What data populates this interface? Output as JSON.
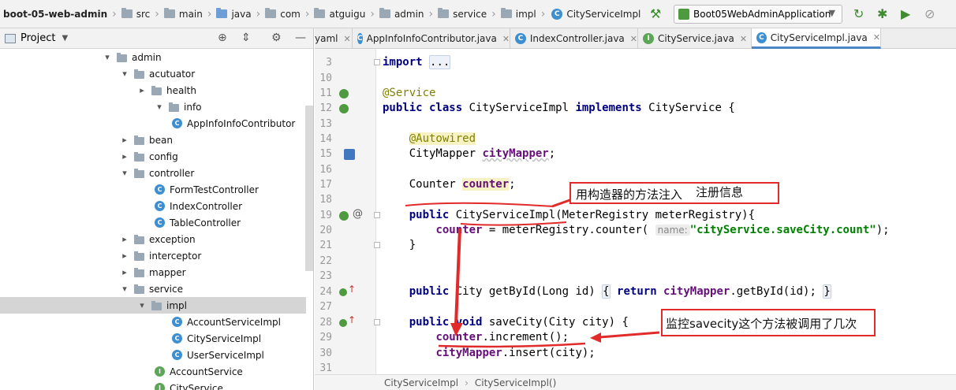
{
  "breadcrumbs": [
    "boot-05-web-admin",
    "src",
    "main",
    "java",
    "com",
    "atguigu",
    "admin",
    "service",
    "impl",
    "CityServiceImpl"
  ],
  "run_config": "Boot05WebAdminApplication",
  "project_panel": {
    "title": "Project"
  },
  "tree": [
    {
      "label": "admin",
      "kind": "folder",
      "toggle": "▾"
    },
    {
      "label": "acutuator",
      "kind": "folder",
      "toggle": "▾"
    },
    {
      "label": "health",
      "kind": "folder",
      "toggle": "▸"
    },
    {
      "label": "info",
      "kind": "folder",
      "toggle": "▾"
    },
    {
      "label": "AppInfoInfoContributor",
      "kind": "class",
      "toggle": ""
    },
    {
      "label": "bean",
      "kind": "folder",
      "toggle": "▸"
    },
    {
      "label": "config",
      "kind": "folder",
      "toggle": "▸"
    },
    {
      "label": "controller",
      "kind": "folder",
      "toggle": "▾"
    },
    {
      "label": "FormTestController",
      "kind": "class",
      "toggle": ""
    },
    {
      "label": "IndexController",
      "kind": "class",
      "toggle": ""
    },
    {
      "label": "TableController",
      "kind": "class",
      "toggle": ""
    },
    {
      "label": "exception",
      "kind": "folder",
      "toggle": "▸"
    },
    {
      "label": "interceptor",
      "kind": "folder",
      "toggle": "▸"
    },
    {
      "label": "mapper",
      "kind": "folder",
      "toggle": "▸"
    },
    {
      "label": "service",
      "kind": "folder",
      "toggle": "▾"
    },
    {
      "label": "impl",
      "kind": "folder",
      "toggle": "▾"
    },
    {
      "label": "AccountServiceImpl",
      "kind": "class",
      "toggle": ""
    },
    {
      "label": "CityServiceImpl",
      "kind": "class",
      "toggle": ""
    },
    {
      "label": "UserServiceImpl",
      "kind": "class",
      "toggle": ""
    },
    {
      "label": "AccountService",
      "kind": "interface",
      "toggle": ""
    },
    {
      "label": "CityService",
      "kind": "interface",
      "toggle": ""
    }
  ],
  "tabs": [
    {
      "label": "yaml",
      "icon": "none"
    },
    {
      "label": "AppInfoInfoContributor.java",
      "icon": "class"
    },
    {
      "label": "IndexController.java",
      "icon": "class"
    },
    {
      "label": "CityService.java",
      "icon": "interface"
    },
    {
      "label": "CityServiceImpl.java",
      "icon": "class"
    }
  ],
  "line_numbers": [
    "3",
    "10",
    "11",
    "12",
    "13",
    "14",
    "15",
    "16",
    "17",
    "18",
    "19",
    "20",
    "21",
    "22",
    "23",
    "24",
    "27",
    "28",
    "29",
    "30",
    "31"
  ],
  "code_tokens": {
    "import_kw": "import",
    "import_fold": "...",
    "service_ann": "@Service",
    "l12_public": "public class",
    "l12_name": " CityServiceImpl ",
    "l12_implements": "implements",
    "l12_rest": " CityService {",
    "autowired": "@Autowired",
    "l15_type": "CityMapper ",
    "l15_field": "cityMapper",
    "semicolon": ";",
    "l17_type": "Counter ",
    "l17_field": "counter",
    "public_kw": "public",
    "l19_rest": " CityServiceImpl(MeterRegistry meterRegistry){",
    "counter_field": "counter",
    "l20_mid": " = meterRegistry.counter( ",
    "l20_hint": "name:",
    "l20_str": "\"cityService.saveCity.count\"",
    "l20_end": ");",
    "close_brace": "}",
    "l24_mid": " City getById(Long id) ",
    "l24_open": "{",
    "return_kw": "return",
    "l24_field": " cityMapper",
    "l24_tail": ".getById(id); ",
    "void_kw": "void",
    "l28_rest": " saveCity(City city) {",
    "l29_rest": ".increment();",
    "l30_field": "cityMapper",
    "l30_rest": ".insert(city);"
  },
  "status_path": [
    "CityServiceImpl",
    "CityServiceImpl()"
  ],
  "annotations": {
    "note_constructor": "用构造器的方法注入",
    "note_register": "注册信息",
    "note_monitor": "监控savecity这个方法被调用了几次"
  },
  "colors": {
    "annotation": "#e12a2a",
    "keyword": "#000080",
    "field": "#660e7a",
    "string": "#008000",
    "selection": "#d5d5d5"
  }
}
